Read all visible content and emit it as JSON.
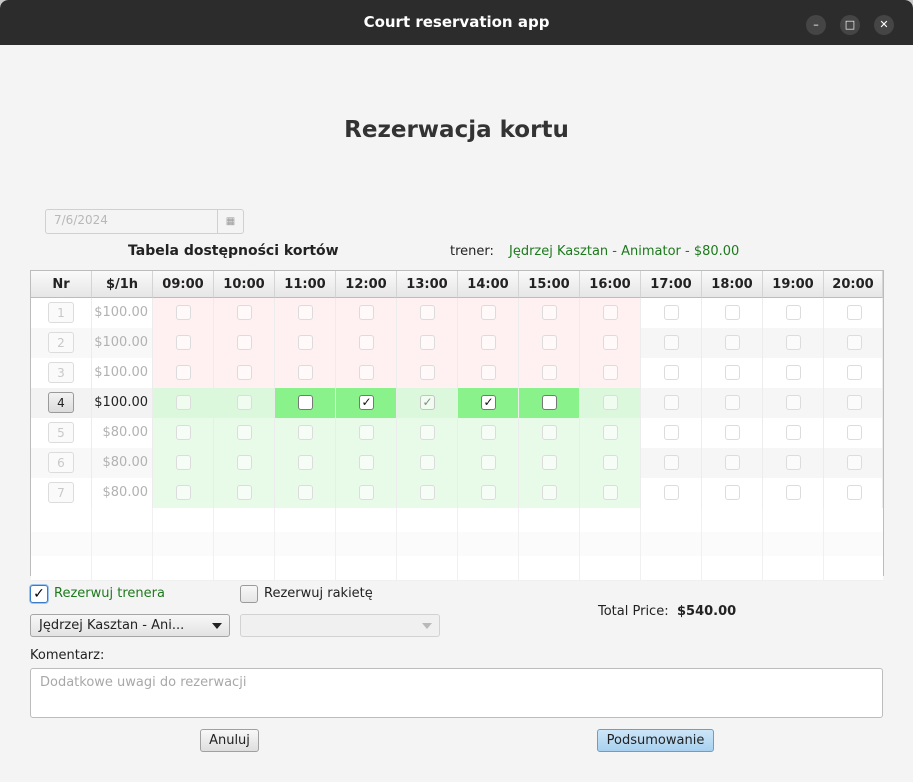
{
  "window": {
    "title": "Court reservation app",
    "controls": [
      {
        "name": "minimize-icon",
        "glyph": "–"
      },
      {
        "name": "maximize-icon",
        "glyph": "□"
      },
      {
        "name": "close-icon",
        "glyph": "✕"
      }
    ]
  },
  "page": {
    "heading": "Rezerwacja kortu",
    "date": "7/6/2024",
    "date_icon": "▦",
    "table_title": "Tabela dostępności kortów",
    "trainer_label": "trener:",
    "trainer_value": "Jędrzej Kasztan - Animator - $80.00"
  },
  "table": {
    "headers": [
      "Nr",
      "$/1h",
      "09:00",
      "10:00",
      "11:00",
      "12:00",
      "13:00",
      "14:00",
      "15:00",
      "16:00",
      "17:00",
      "18:00",
      "19:00",
      "20:00"
    ],
    "rows": [
      {
        "nr": "1",
        "price": "$100.00",
        "active": false
      },
      {
        "nr": "2",
        "price": "$100.00",
        "active": false
      },
      {
        "nr": "3",
        "price": "$100.00",
        "active": false
      },
      {
        "nr": "4",
        "price": "$100.00",
        "active": true
      },
      {
        "nr": "5",
        "price": "$80.00",
        "active": false
      },
      {
        "nr": "6",
        "price": "$80.00",
        "active": false
      },
      {
        "nr": "7",
        "price": "$80.00",
        "active": false
      }
    ],
    "checked": {
      "3": [
        3,
        5
      ],
      "3_mid": [
        4
      ]
    },
    "colors": {
      "unavailable": "#fff1f1",
      "available": "#e8fbe8",
      "available_strong": "#dcf8dc",
      "selected": "#8af28a",
      "neutral": "#ffffff",
      "neutral_alt": "#f6f6f6"
    }
  },
  "options": {
    "trainer_checkbox": "Rezerwuj trenera",
    "trainer_checked": true,
    "racket_checkbox": "Rezerwuj rakietę",
    "racket_checked": false,
    "trainer_select": "Jędrzej Kasztan - Ani...",
    "racket_select": "",
    "total_label": "Total Price:",
    "total_value": "$540.00",
    "comment_label": "Komentarz:",
    "comment_placeholder": "Dodatkowe uwagi do rezerwacji",
    "cancel": "Anuluj",
    "summary": "Podsumowanie"
  }
}
